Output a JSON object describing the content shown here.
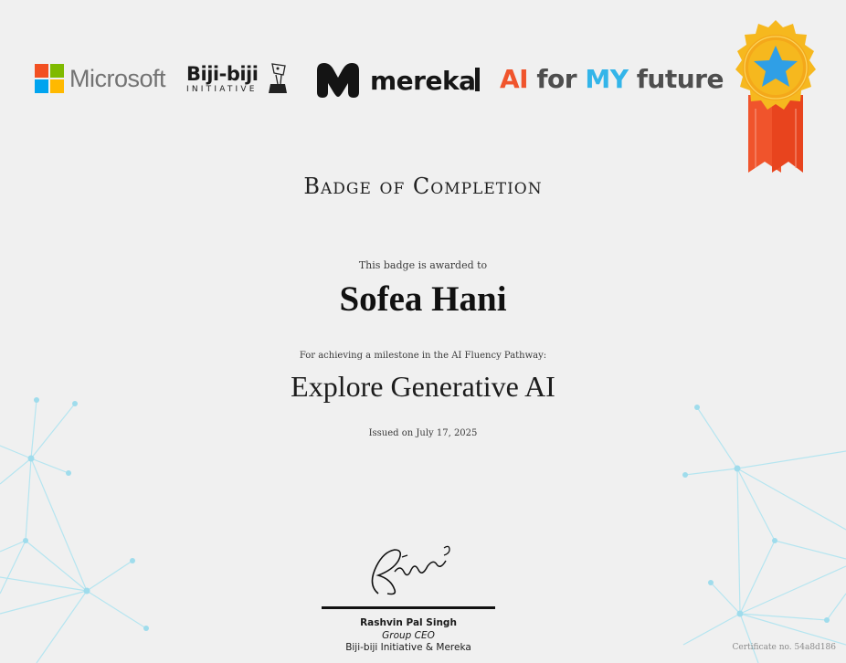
{
  "logos": {
    "microsoft": {
      "text": "Microsoft",
      "colors": [
        "#f25022",
        "#7fba00",
        "#00a4ef",
        "#ffb900"
      ]
    },
    "biji_biji": {
      "name": "Biji-biji",
      "subtitle": "INITIATIVE"
    },
    "mereka": {
      "text": "mereka",
      "icon": "mereka-m-icon"
    },
    "ai_for_my_future": {
      "part1": "AI",
      "part2": " for ",
      "part3": "MY",
      "part4": " future"
    }
  },
  "certificate": {
    "title": "Badge of Completion",
    "awarded_to_label": "This badge is awarded to",
    "recipient": "Sofea Hani",
    "milestone_label": "For achieving a milestone in the AI Fluency Pathway:",
    "course": "Explore Generative AI",
    "issued": "Issued on July 17, 2025",
    "certificate_number": "Certificate no. 54a8d186"
  },
  "signatory": {
    "name": "Rashvin Pal Singh",
    "role": "Group CEO",
    "organization": "Biji-biji Initiative & Mereka"
  },
  "icons": {
    "award": "award-ribbon-star-icon",
    "signature": "handwritten-signature"
  },
  "colors": {
    "background": "#f0f0f0",
    "network": "#a8e1ee",
    "ai_orange": "#f0542c",
    "ai_blue": "#33b5e9",
    "medal_gold": "#f6b81e",
    "ribbon": "#f0542c",
    "star": "#2f9fe6"
  }
}
